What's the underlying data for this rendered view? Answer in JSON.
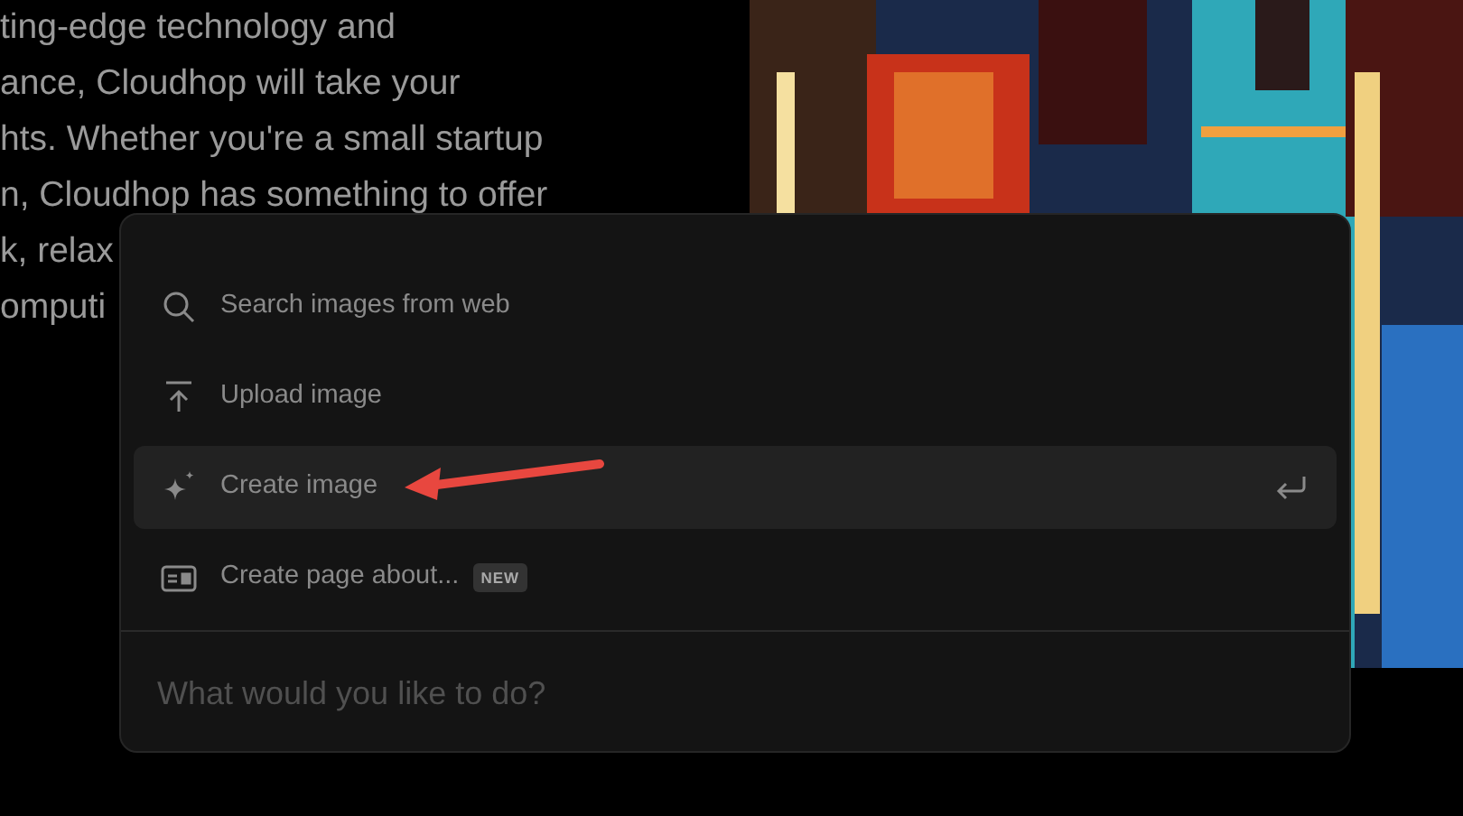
{
  "background_text": [
    "ting-edge technology and",
    "ance, Cloudhop will take your",
    "hts. Whether you're a small startup",
    "n, Cloudhop has something to offer",
    "k, relax",
    "omputi"
  ],
  "menu": {
    "items": [
      {
        "kind": "search",
        "label": "Search images from web",
        "selected": false
      },
      {
        "kind": "upload",
        "label": "Upload image",
        "selected": false
      },
      {
        "kind": "sparkle",
        "label": "Create image",
        "selected": true
      },
      {
        "kind": "page",
        "label": "Create page about...",
        "badge": "NEW",
        "selected": false
      }
    ],
    "prompt": {
      "placeholder": "What would you like to do?"
    }
  }
}
